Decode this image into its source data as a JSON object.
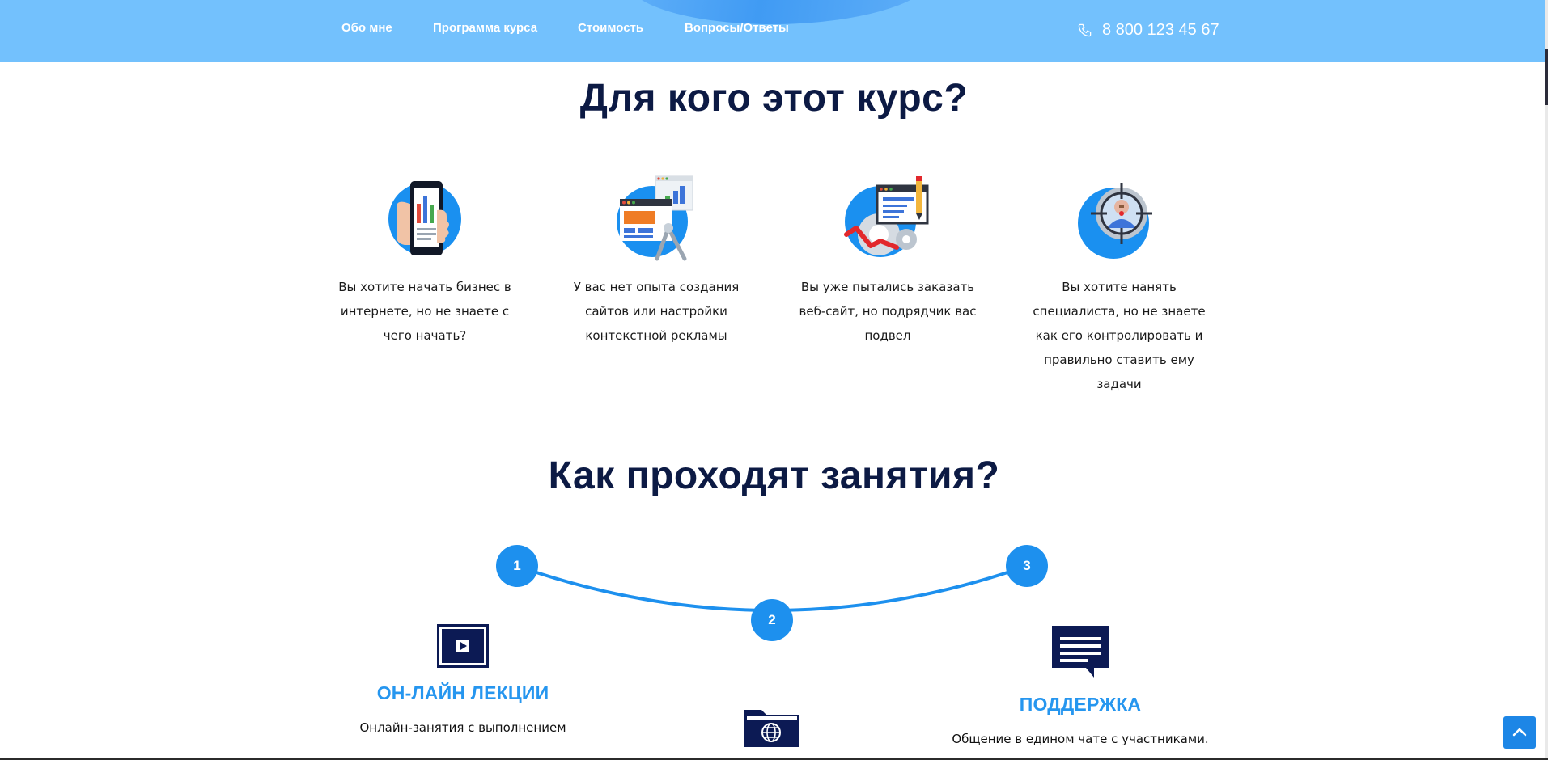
{
  "header": {
    "nav": [
      {
        "label": "Обо мне"
      },
      {
        "label": "Программа курса"
      },
      {
        "label": "Стоимость"
      },
      {
        "label": "Вопросы/Ответы"
      }
    ],
    "phone": "8 800 123 45 67"
  },
  "audience": {
    "title": "Для кого этот курс?",
    "items": [
      {
        "icon": "phone-analytics-icon",
        "text": "Вы хотите начать бизнес в интернете, но не знаете с чего начать?"
      },
      {
        "icon": "web-design-icon",
        "text": "У вас нет опыта создания сайтов или настройки контекстной рекламы"
      },
      {
        "icon": "website-settings-icon",
        "text": "Вы уже пытались заказать веб-сайт, но подрядчик вас подвел"
      },
      {
        "icon": "target-person-icon",
        "text": "Вы хотите нанять специалиста, но не знаете как его контролировать и правильно ставить ему задачи"
      }
    ]
  },
  "format": {
    "title": "Как проходят занятия?",
    "steps": [
      "1",
      "2",
      "3"
    ],
    "items": [
      {
        "icon": "video-play-icon",
        "title": "ОН-ЛАЙН ЛЕКЦИИ",
        "text": "Онлайн-занятия с выполнением"
      },
      {
        "icon": "web-folder-icon"
      },
      {
        "icon": "chat-bubble-icon",
        "title": "ПОДДЕРЖКА",
        "text": "Общение в едином чате с участниками."
      }
    ]
  },
  "colors": {
    "header_bg": "#73c1fd",
    "accent": "#1d90ee",
    "heading": "#0c1a44"
  }
}
